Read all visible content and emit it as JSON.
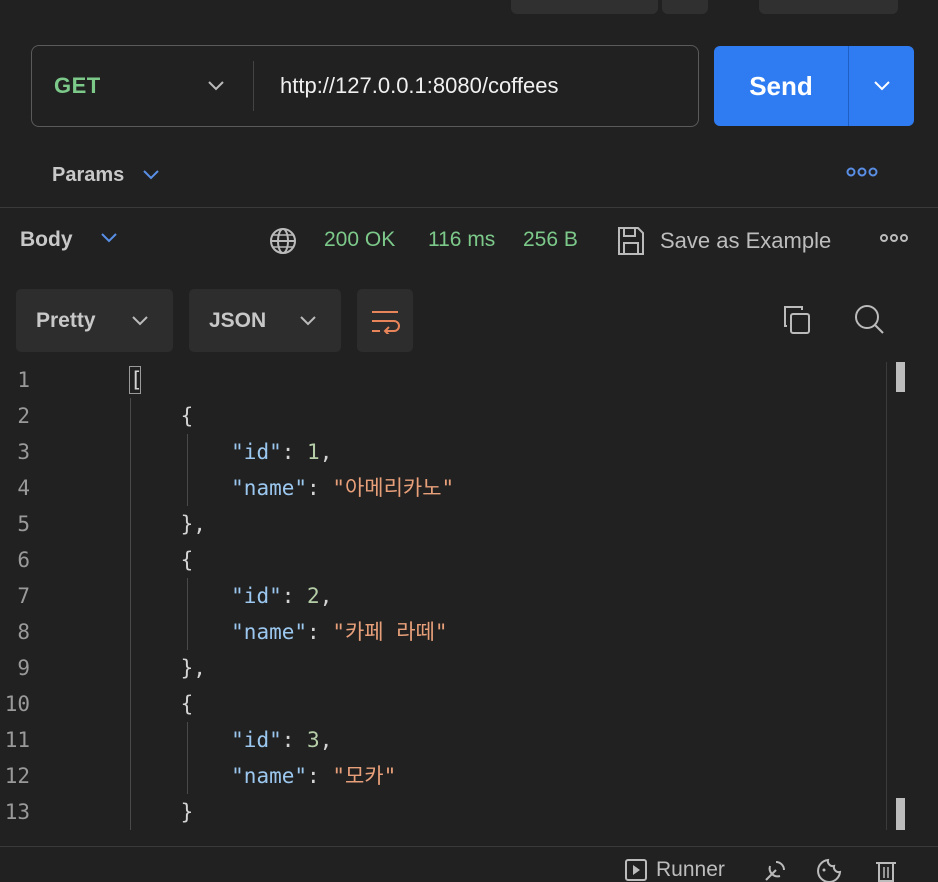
{
  "request": {
    "method": "GET",
    "url": "http://127.0.0.1:8080/coffees",
    "send_label": "Send",
    "params_label": "Params"
  },
  "response": {
    "body_label": "Body",
    "status": "200 OK",
    "time": "116 ms",
    "size": "256 B",
    "save_label": "Save as Example",
    "format_label": "Pretty",
    "language_label": "JSON"
  },
  "editor": {
    "line_numbers": [
      "1",
      "2",
      "3",
      "4",
      "5",
      "6",
      "7",
      "8",
      "9",
      "10",
      "11",
      "12",
      "13"
    ],
    "items": [
      {
        "id": "1",
        "name": "\"아메리카노\""
      },
      {
        "id": "2",
        "name": "\"카페 라떼\""
      },
      {
        "id": "3",
        "name": "\"모카\""
      }
    ],
    "key_id": "\"id\"",
    "key_name": "\"name\""
  },
  "footer": {
    "runner_label": "Runner"
  },
  "colors": {
    "accent": "#2f7cf2",
    "success": "#7cc98a",
    "string": "#e8a07a",
    "key": "#9cc8f0"
  }
}
